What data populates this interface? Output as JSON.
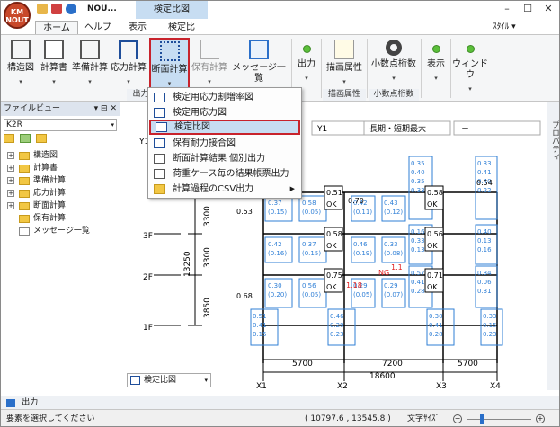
{
  "app": {
    "logo_line1": "KM",
    "logo_line2": "NOUT",
    "title": "NOU...",
    "context_tab": "検定比図",
    "style_label": "ｽﾀｲﾙ ▾"
  },
  "tabs": [
    "ホーム",
    "ヘルプ",
    "表示",
    "検定比"
  ],
  "ribbon": {
    "buttons": [
      "構造図",
      "計算書",
      "準備計算",
      "応力計算",
      "断面計算",
      "保有計算",
      "メッセージ一覧",
      "出力",
      "描画属性",
      "小数点桁数",
      "表示",
      "ウィンドウ"
    ],
    "groups": {
      "output": "出力フ",
      "draw": "描画属性",
      "decimals": "小数点桁数"
    }
  },
  "file_view": {
    "title": "ファイルビュー",
    "pin": "▾ ⊟ ✕",
    "project": "K2R",
    "tree": [
      {
        "label": "構造図"
      },
      {
        "label": "計算書"
      },
      {
        "label": "準備計算"
      },
      {
        "label": "応力計算"
      },
      {
        "label": "断面計算"
      },
      {
        "label": "保有計算"
      },
      {
        "label": "メッセージ一覧"
      }
    ]
  },
  "properties_label": "プロパティ",
  "menu": {
    "items": [
      "検定用応力割増率図",
      "検定用応力図",
      "検定比図",
      "保有耐力接合図",
      "断面計算結果 個別出力",
      "荷重ケース毎の結果帳票出力",
      "計算過程のCSV出力"
    ]
  },
  "drawing": {
    "frame_select": "Y1",
    "case_select": "長期・短期最大",
    "extra_select": "－",
    "frame_label": "Y1",
    "floors": [
      "3F",
      "2F",
      "1F"
    ],
    "heights": [
      "3300",
      "3300",
      "3850"
    ],
    "total_height": "13250",
    "spans": [
      "5700",
      "7200",
      "5700"
    ],
    "total_span": "18600",
    "axes": [
      "X1",
      "X2",
      "X3",
      "X4"
    ],
    "top_values": [
      "0.51",
      "0.58",
      "0.54",
      "0.53",
      "0.58",
      "0.56",
      "0.70",
      "0.68",
      "0.75",
      "0.71"
    ],
    "ng_label": "NG",
    "ng_values": [
      "1.18",
      "1.1"
    ],
    "ok_label": "OK"
  },
  "view_select": "検定比図",
  "bottom": {
    "output_tab": "出力"
  },
  "status": {
    "message": "要素を選択してください",
    "coords": "( 10797.6 , 13545.8 )",
    "font_size_label": "文字ｻｲｽﾞ"
  },
  "colors": {
    "accent": "#c8232c",
    "ok_box": "#2f7fd6",
    "ng": "#e02020",
    "selected": "#c7ddf2"
  }
}
